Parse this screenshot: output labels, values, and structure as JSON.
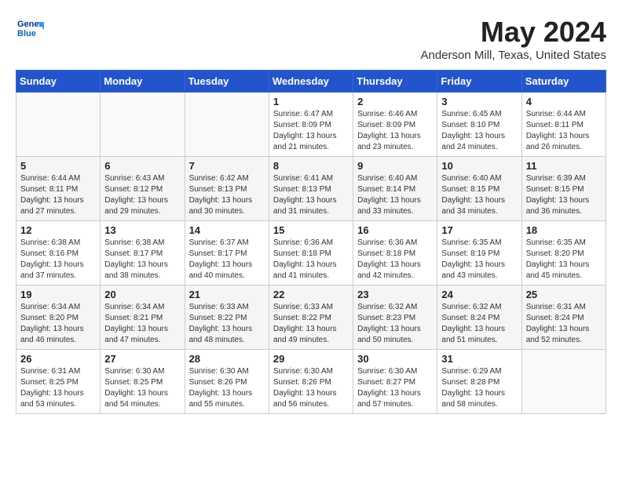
{
  "header": {
    "logo_line1": "General",
    "logo_line2": "Blue",
    "month_title": "May 2024",
    "location": "Anderson Mill, Texas, United States"
  },
  "weekdays": [
    "Sunday",
    "Monday",
    "Tuesday",
    "Wednesday",
    "Thursday",
    "Friday",
    "Saturday"
  ],
  "weeks": [
    [
      {
        "day": "",
        "info": ""
      },
      {
        "day": "",
        "info": ""
      },
      {
        "day": "",
        "info": ""
      },
      {
        "day": "1",
        "info": "Sunrise: 6:47 AM\nSunset: 8:09 PM\nDaylight: 13 hours\nand 21 minutes."
      },
      {
        "day": "2",
        "info": "Sunrise: 6:46 AM\nSunset: 8:09 PM\nDaylight: 13 hours\nand 23 minutes."
      },
      {
        "day": "3",
        "info": "Sunrise: 6:45 AM\nSunset: 8:10 PM\nDaylight: 13 hours\nand 24 minutes."
      },
      {
        "day": "4",
        "info": "Sunrise: 6:44 AM\nSunset: 8:11 PM\nDaylight: 13 hours\nand 26 minutes."
      }
    ],
    [
      {
        "day": "5",
        "info": "Sunrise: 6:44 AM\nSunset: 8:11 PM\nDaylight: 13 hours\nand 27 minutes."
      },
      {
        "day": "6",
        "info": "Sunrise: 6:43 AM\nSunset: 8:12 PM\nDaylight: 13 hours\nand 29 minutes."
      },
      {
        "day": "7",
        "info": "Sunrise: 6:42 AM\nSunset: 8:13 PM\nDaylight: 13 hours\nand 30 minutes."
      },
      {
        "day": "8",
        "info": "Sunrise: 6:41 AM\nSunset: 8:13 PM\nDaylight: 13 hours\nand 31 minutes."
      },
      {
        "day": "9",
        "info": "Sunrise: 6:40 AM\nSunset: 8:14 PM\nDaylight: 13 hours\nand 33 minutes."
      },
      {
        "day": "10",
        "info": "Sunrise: 6:40 AM\nSunset: 8:15 PM\nDaylight: 13 hours\nand 34 minutes."
      },
      {
        "day": "11",
        "info": "Sunrise: 6:39 AM\nSunset: 8:15 PM\nDaylight: 13 hours\nand 36 minutes."
      }
    ],
    [
      {
        "day": "12",
        "info": "Sunrise: 6:38 AM\nSunset: 8:16 PM\nDaylight: 13 hours\nand 37 minutes."
      },
      {
        "day": "13",
        "info": "Sunrise: 6:38 AM\nSunset: 8:17 PM\nDaylight: 13 hours\nand 38 minutes."
      },
      {
        "day": "14",
        "info": "Sunrise: 6:37 AM\nSunset: 8:17 PM\nDaylight: 13 hours\nand 40 minutes."
      },
      {
        "day": "15",
        "info": "Sunrise: 6:36 AM\nSunset: 8:18 PM\nDaylight: 13 hours\nand 41 minutes."
      },
      {
        "day": "16",
        "info": "Sunrise: 6:36 AM\nSunset: 8:18 PM\nDaylight: 13 hours\nand 42 minutes."
      },
      {
        "day": "17",
        "info": "Sunrise: 6:35 AM\nSunset: 8:19 PM\nDaylight: 13 hours\nand 43 minutes."
      },
      {
        "day": "18",
        "info": "Sunrise: 6:35 AM\nSunset: 8:20 PM\nDaylight: 13 hours\nand 45 minutes."
      }
    ],
    [
      {
        "day": "19",
        "info": "Sunrise: 6:34 AM\nSunset: 8:20 PM\nDaylight: 13 hours\nand 46 minutes."
      },
      {
        "day": "20",
        "info": "Sunrise: 6:34 AM\nSunset: 8:21 PM\nDaylight: 13 hours\nand 47 minutes."
      },
      {
        "day": "21",
        "info": "Sunrise: 6:33 AM\nSunset: 8:22 PM\nDaylight: 13 hours\nand 48 minutes."
      },
      {
        "day": "22",
        "info": "Sunrise: 6:33 AM\nSunset: 8:22 PM\nDaylight: 13 hours\nand 49 minutes."
      },
      {
        "day": "23",
        "info": "Sunrise: 6:32 AM\nSunset: 8:23 PM\nDaylight: 13 hours\nand 50 minutes."
      },
      {
        "day": "24",
        "info": "Sunrise: 6:32 AM\nSunset: 8:24 PM\nDaylight: 13 hours\nand 51 minutes."
      },
      {
        "day": "25",
        "info": "Sunrise: 6:31 AM\nSunset: 8:24 PM\nDaylight: 13 hours\nand 52 minutes."
      }
    ],
    [
      {
        "day": "26",
        "info": "Sunrise: 6:31 AM\nSunset: 8:25 PM\nDaylight: 13 hours\nand 53 minutes."
      },
      {
        "day": "27",
        "info": "Sunrise: 6:30 AM\nSunset: 8:25 PM\nDaylight: 13 hours\nand 54 minutes."
      },
      {
        "day": "28",
        "info": "Sunrise: 6:30 AM\nSunset: 8:26 PM\nDaylight: 13 hours\nand 55 minutes."
      },
      {
        "day": "29",
        "info": "Sunrise: 6:30 AM\nSunset: 8:26 PM\nDaylight: 13 hours\nand 56 minutes."
      },
      {
        "day": "30",
        "info": "Sunrise: 6:30 AM\nSunset: 8:27 PM\nDaylight: 13 hours\nand 57 minutes."
      },
      {
        "day": "31",
        "info": "Sunrise: 6:29 AM\nSunset: 8:28 PM\nDaylight: 13 hours\nand 58 minutes."
      },
      {
        "day": "",
        "info": ""
      }
    ]
  ]
}
